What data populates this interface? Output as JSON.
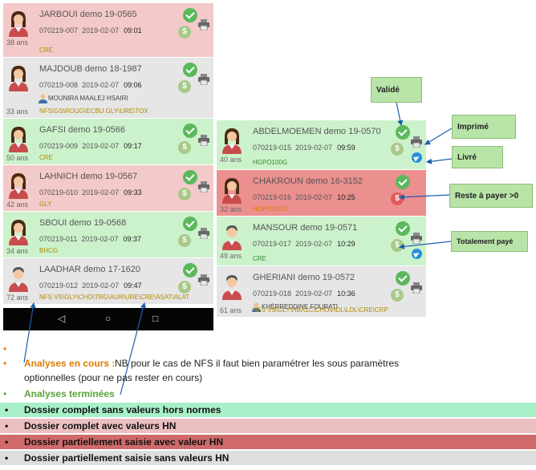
{
  "left_cards": [
    {
      "name": "JARBOUI demo 19-0565",
      "code": "070219-007",
      "date": "2019-02-07",
      "time": "09:01",
      "age": "38 ans",
      "tests": "CRE",
      "doctor": "",
      "bg": "#f4c9c9",
      "gender": "female"
    },
    {
      "name": "MAJDOUB demo 18-1987",
      "code": "070219-008",
      "date": "2019-02-07",
      "time": "09:06",
      "age": "33 ans",
      "tests": "NFS\\GS\\ROUG\\ECBU GLY\\URE\\TOX",
      "doctor": "MOUNIRA MAALEJ HSAIRI",
      "bg": "#e6e6e6",
      "gender": "female"
    },
    {
      "name": "GAFSI  demo 19-0566",
      "code": "070219-009",
      "date": "2019-02-07",
      "time": "09:17",
      "age": "50 ans",
      "tests": "CRE",
      "doctor": "",
      "bg": "#ccf2cc",
      "gender": "female"
    },
    {
      "name": "LAHNICH  demo 19-0567",
      "code": "070219-010",
      "date": "2019-02-07",
      "time": "09:33",
      "age": "42 ans",
      "tests": "GLY",
      "doctor": "",
      "bg": "#f4c9c9",
      "gender": "female"
    },
    {
      "name": "SBOUI  demo 19-0568",
      "code": "070219-011",
      "date": "2019-02-07",
      "time": "09:37",
      "age": "34 ans",
      "tests": "BHCG",
      "doctor": "",
      "bg": "#ccf2cc",
      "gender": "female"
    },
    {
      "name": "LAADHAR demo 17-1620",
      "code": "070219-012",
      "date": "2019-02-07",
      "time": "09:47",
      "age": "72 ans",
      "tests": "NFS  VS\\GLY\\CHO\\TRG\\AUR\\URE\\CRE\\ASAT\\ALAT",
      "doctor": "",
      "bg": "#e6e6e6",
      "gender": "male"
    }
  ],
  "right_cards": [
    {
      "name": "ABDELMOEMEN demo 19-0570",
      "code": "070219-015",
      "date": "2019-02-07",
      "time": "09:59",
      "age": "40 ans",
      "tests": "HGPO100G",
      "doctor": "",
      "bg": "#ccf2cc",
      "gender": "female"
    },
    {
      "name": "CHAKROUN demo 16-3152",
      "code": "070219-016",
      "date": "2019-02-07",
      "time": "10:25",
      "age": "32 ans",
      "tests": "HGPO100G",
      "doctor": "",
      "bg": "#ec8f8f",
      "gender": "female"
    },
    {
      "name": "MANSOUR demo 19-0571",
      "code": "070219-017",
      "date": "2019-02-07",
      "time": "10:29",
      "age": "49 ans",
      "tests": "CRE",
      "doctor": "",
      "bg": "#ccf2cc",
      "gender": "male"
    },
    {
      "name": "GHERIANI demo 19-0572",
      "code": "070219-018",
      "date": "2019-02-07",
      "time": "10:36",
      "age": "61 ans",
      "tests": "NFS  VS\\GLY\\HBA1C\\CHO\\HDL\\LDL\\CRE\\CRP",
      "doctor": "KHÉRREDDINE FOURATI",
      "bg": "#e6e6e6",
      "gender": "male"
    }
  ],
  "callouts": {
    "valide": "Validé",
    "imprime": "Imprimé",
    "livre": "Livré",
    "reste": "Reste à payer >0",
    "totalement": "Totalement payé"
  },
  "navbar": {
    "back": "◁",
    "home": "○",
    "recent": "□"
  },
  "legend": {
    "cours_title": "Analyses en cours :",
    "cours_text": " NB pour le cas de NFS il faut bien paramétrer les sous paramètres",
    "cours_text2": "optionnelles (pour ne pas rester en cours)",
    "terminees_title": "Analyses terminées",
    "band1": "Dossier complet sans valeurs hors normes",
    "band2": "Dossier complet avec valeurs HN",
    "band3": "Dossier partiellement saisie avec valeur HN",
    "band4": "Dossier partiellement saisie sans valeurs HN"
  },
  "colors": {
    "band1": "#a8f0c8",
    "band2": "#ecc0c0",
    "band3": "#d06a6a",
    "band4": "#dedede",
    "orange": "#e07a00",
    "green": "#2e8a2e"
  }
}
